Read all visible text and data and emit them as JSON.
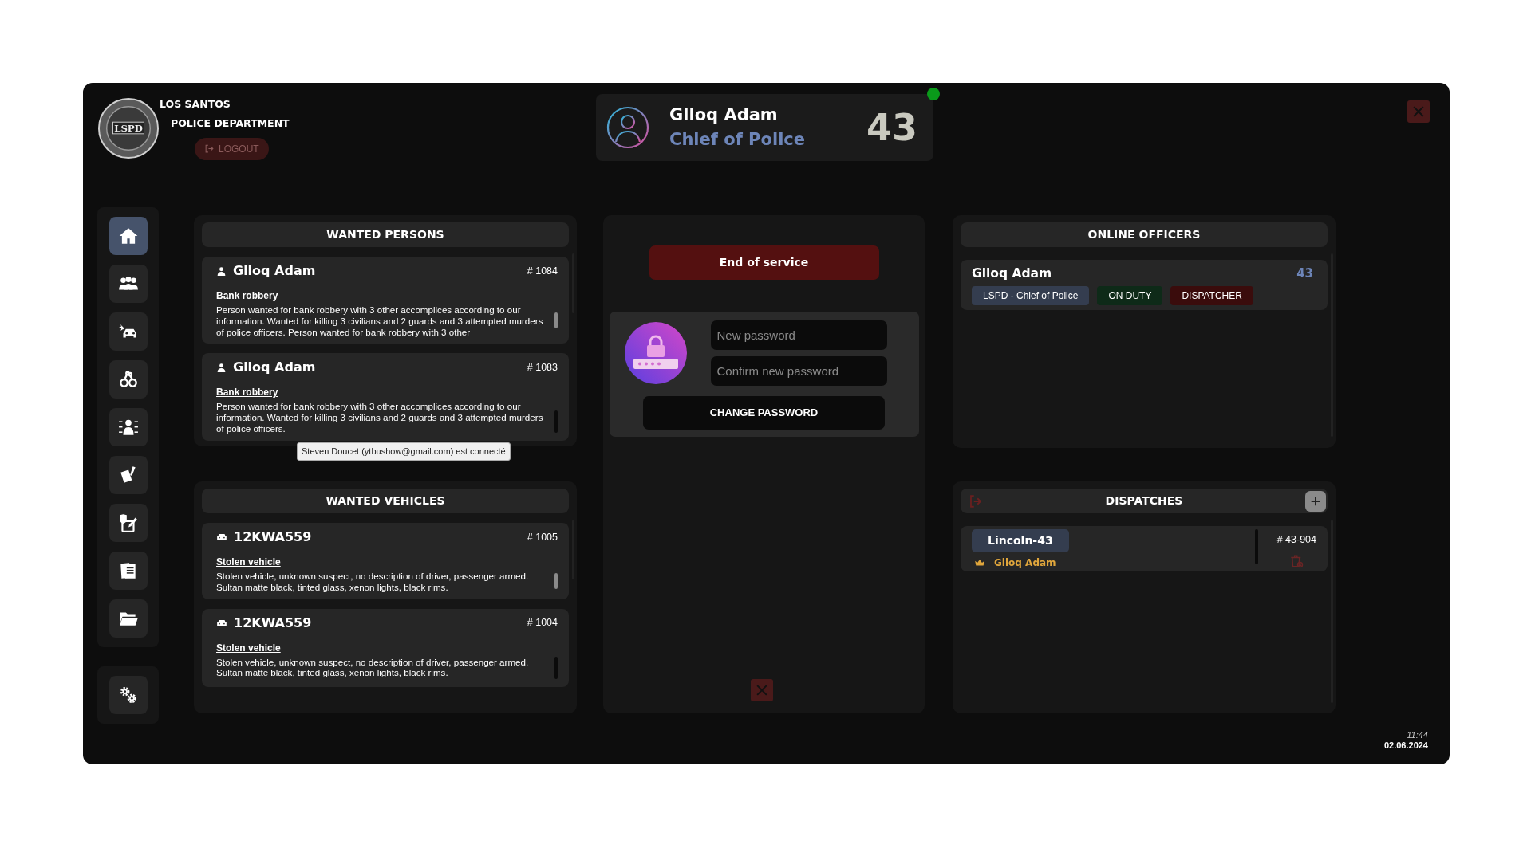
{
  "header": {
    "logo_text": "LSPD",
    "org_line1": "LOS SANTOS",
    "org_line2": "POLICE DEPARTMENT",
    "logout_label": "LOGOUT"
  },
  "profile": {
    "name": "Glloq Adam",
    "rank": "Chief of Police",
    "badge_number": "43",
    "online": true
  },
  "sidebar": {
    "items": [
      {
        "kind": "home",
        "selected": true
      },
      {
        "kind": "people",
        "selected": false
      },
      {
        "kind": "car-crash",
        "selected": false
      },
      {
        "kind": "handcuffs",
        "selected": false
      },
      {
        "kind": "mugshot",
        "selected": false
      },
      {
        "kind": "report",
        "selected": false
      },
      {
        "kind": "form",
        "selected": false
      },
      {
        "kind": "documents",
        "selected": false
      },
      {
        "kind": "folder",
        "selected": false
      }
    ],
    "bottom_items": [
      {
        "kind": "gears",
        "selected": false
      }
    ]
  },
  "wanted_persons": {
    "title": "WANTED PERSONS",
    "entries": [
      {
        "name": "Glloq Adam",
        "number": "# 1084",
        "offense": "Bank robbery",
        "description": "Person wanted for bank robbery with 3 other accomplices according to our information. Wanted for killing 3 civilians and 2 guards and 3 attempted murders of police officers. Person wanted for bank robbery with 3 other"
      },
      {
        "name": "Glloq Adam",
        "number": "# 1083",
        "offense": "Bank robbery",
        "description": "Person wanted for bank robbery with 3 other accomplices according to our information. Wanted for killing 3 civilians and 2 guards and 3 attempted murders of police officers."
      }
    ]
  },
  "tooltip": {
    "text": "Steven Doucet (ytbushow@gmail.com) est connecté"
  },
  "wanted_vehicles": {
    "title": "WANTED VEHICLES",
    "entries": [
      {
        "plate": "12KWA559",
        "number": "# 1005",
        "offense": "Stolen vehicle",
        "description": "Stolen vehicle, unknown suspect, no description of driver, passenger armed. Sultan matte black, tinted glass, xenon lights, black rims."
      },
      {
        "plate": "12KWA559",
        "number": "# 1004",
        "offense": "Stolen vehicle",
        "description": "Stolen vehicle, unknown suspect, no description of driver, passenger armed. Sultan matte black, tinted glass, xenon lights, black rims."
      }
    ]
  },
  "service": {
    "end_label": "End of service"
  },
  "password": {
    "new_placeholder": "New password",
    "confirm_placeholder": "Confirm new password",
    "submit_label": "CHANGE PASSWORD"
  },
  "online_officers": {
    "title": "ONLINE OFFICERS",
    "officers": [
      {
        "name": "Glloq Adam",
        "number": "43",
        "tags": [
          {
            "label": "LSPD - Chief of Police",
            "color": "#343d4f"
          },
          {
            "label": "ON DUTY",
            "color": "#0e2a18"
          },
          {
            "label": "DISPATCHER",
            "color": "#3a0c0c"
          }
        ]
      }
    ]
  },
  "dispatches": {
    "title": "DISPATCHES",
    "entries": [
      {
        "unit": "Lincoln-43",
        "leader": "Glloq Adam",
        "number": "# 43-904"
      }
    ]
  },
  "clock": {
    "time": "11:44",
    "date": "02.06.2024"
  }
}
